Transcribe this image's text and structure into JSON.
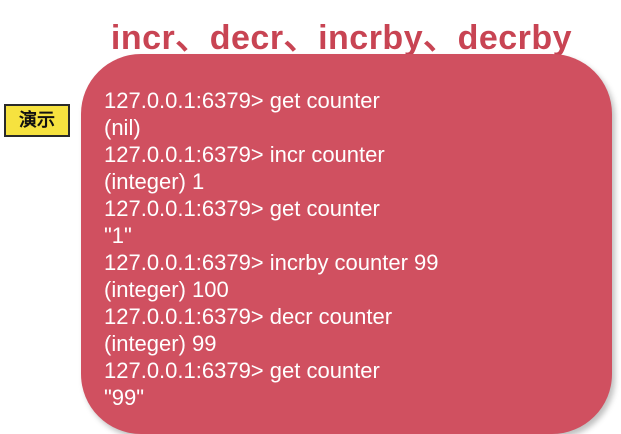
{
  "slide": {
    "title": "incr、decr、incrby、decrby",
    "badge": "演示"
  },
  "terminal": {
    "lines": [
      "127.0.0.1:6379> get counter",
      "(nil)",
      "127.0.0.1:6379> incr counter",
      "(integer) 1",
      "127.0.0.1:6379> get counter",
      "\"1\"",
      "127.0.0.1:6379> incrby counter 99",
      "(integer) 100",
      "127.0.0.1:6379> decr counter",
      "(integer) 99",
      "127.0.0.1:6379> get counter",
      "\"99\""
    ]
  },
  "colors": {
    "title": "#c84453",
    "box": "#d05060",
    "badge": "#f6e23f",
    "text": "#ffffff"
  }
}
